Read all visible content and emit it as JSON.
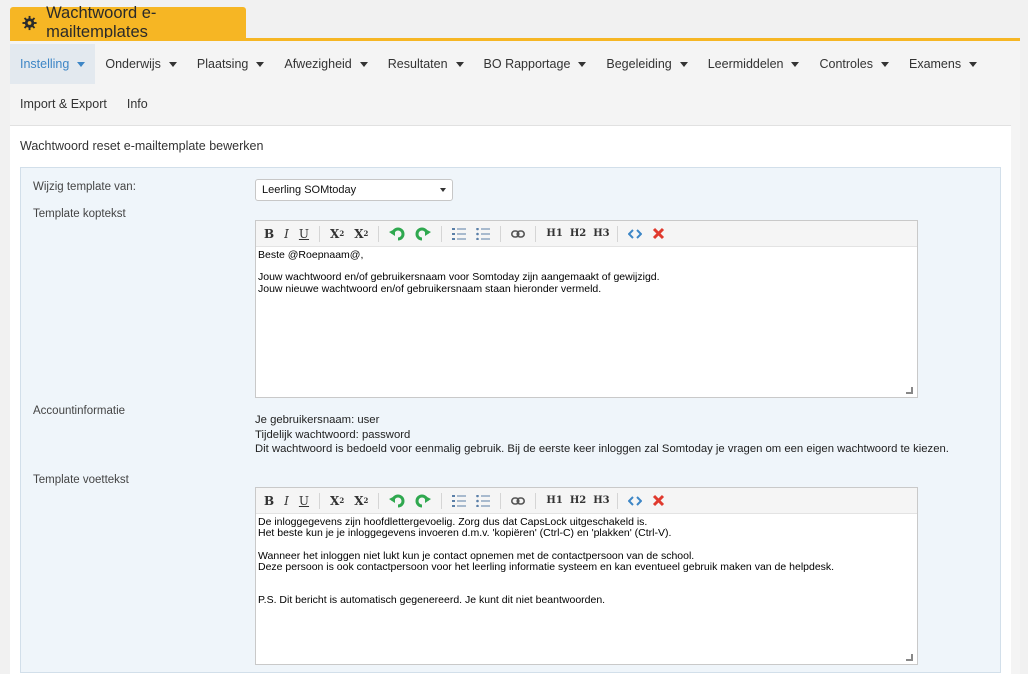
{
  "window": {
    "title": "Wachtwoord e-mailtemplates",
    "icon": "gear-icon"
  },
  "menu": {
    "row1": [
      {
        "label": "Instelling",
        "dropdown": true,
        "active": true
      },
      {
        "label": "Onderwijs",
        "dropdown": true
      },
      {
        "label": "Plaatsing",
        "dropdown": true
      },
      {
        "label": "Afwezigheid",
        "dropdown": true
      },
      {
        "label": "Resultaten",
        "dropdown": true
      },
      {
        "label": "BO Rapportage",
        "dropdown": true
      },
      {
        "label": "Begeleiding",
        "dropdown": true
      },
      {
        "label": "Leermiddelen",
        "dropdown": true
      },
      {
        "label": "Controles",
        "dropdown": true
      },
      {
        "label": "Examens",
        "dropdown": true
      }
    ],
    "row2": [
      {
        "label": "Import & Export"
      },
      {
        "label": "Info"
      }
    ]
  },
  "page": {
    "title": "Wachtwoord reset e-mailtemplate bewerken"
  },
  "form": {
    "template_label": "Wijzig template van:",
    "template_value": "Leerling SOMtoday",
    "header_label": "Template koptekst",
    "header_text": "Beste @Roepnaam@,\n\nJouw wachtwoord en/of gebruikersnaam voor Somtoday zijn aangemaakt of gewijzigd.\nJouw nieuwe wachtwoord en/of gebruikersnaam staan hieronder vermeld.",
    "account_label": "Accountinformatie",
    "account_lines": [
      "Je gebruikersnaam: user",
      "Tijdelijk wachtwoord: password",
      "Dit wachtwoord is bedoeld voor eenmalig gebruik. Bij de eerste keer inloggen zal Somtoday je vragen om een eigen wachtwoord te kiezen."
    ],
    "footer_label": "Template voettekst",
    "footer_text": "De inloggegevens zijn hoofdlettergevoelig. Zorg dus dat CapsLock uitgeschakeld is.\nHet beste kun je je inloggegevens invoeren d.m.v. 'kopiëren' (Ctrl-C) en 'plakken' (Ctrl-V).\n\nWanneer het inloggen niet lukt kun je contact opnemen met de contactpersoon van de school.\nDeze persoon is ook contactpersoon voor het leerling informatie systeem en kan eventueel gebruik maken van de helpdesk.\n\n\nP.S. Dit bericht is automatisch gegenereerd. Je kunt dit niet beantwoorden."
  },
  "toolbar": {
    "bold": "B",
    "italic": "I",
    "underline": "U",
    "subscript": "X",
    "subscript_small": "2",
    "superscript": "X",
    "superscript_small": "2",
    "h1": "H1",
    "h2": "H2",
    "h3": "H3"
  },
  "colors": {
    "accent": "#f6b624",
    "link": "#3d86c6",
    "undo_redo": "#2fa84f",
    "remove": "#e03a2e",
    "source": "#3d86c6"
  }
}
